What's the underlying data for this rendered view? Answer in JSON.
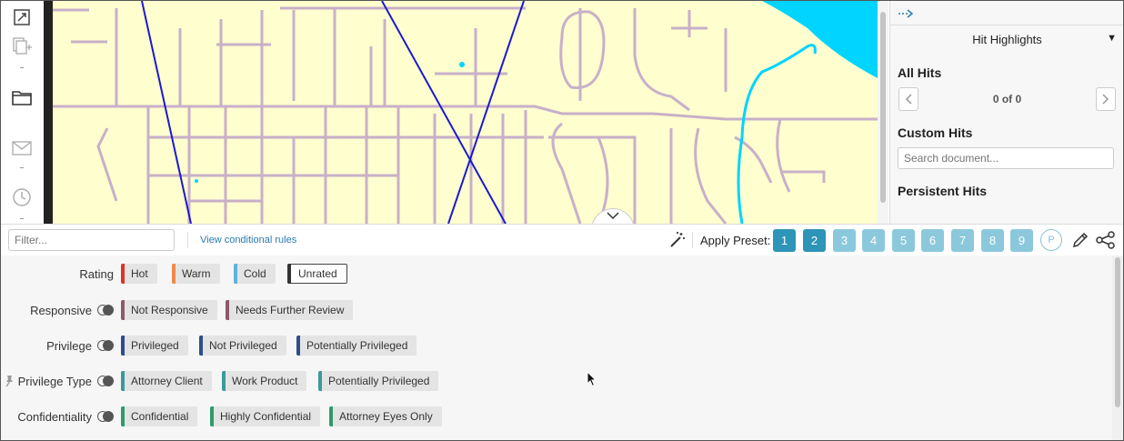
{
  "left_toolbar": {
    "icons": [
      "expand-icon",
      "copy-add-icon",
      "folder-icon",
      "mail-icon",
      "clock-icon"
    ]
  },
  "right_panel": {
    "title": "Hit Highlights",
    "all_hits_label": "All Hits",
    "hits_count": "0 of 0",
    "custom_hits_label": "Custom Hits",
    "search_placeholder": "Search document...",
    "persistent_hits_label": "Persistent Hits"
  },
  "filter_bar": {
    "filter_placeholder": "Filter...",
    "conditional_rules_link": "View conditional rules",
    "apply_preset_label": "Apply Preset:",
    "presets": [
      "1",
      "2",
      "3",
      "4",
      "5",
      "6",
      "7",
      "8",
      "9"
    ],
    "preset_personal": "P",
    "active_presets": [
      "1",
      "2"
    ]
  },
  "coding": {
    "rating": {
      "label": "Rating",
      "choices": [
        {
          "label": "Hot",
          "color": "#d9342b"
        },
        {
          "label": "Warm",
          "color": "#f0894a"
        },
        {
          "label": "Cold",
          "color": "#5ab4dc"
        },
        {
          "label": "Unrated",
          "color": "#333333",
          "selected": true
        }
      ]
    },
    "responsive": {
      "label": "Responsive",
      "choices": [
        {
          "label": "Not Responsive",
          "color": "#8c5a6a"
        },
        {
          "label": "Needs Further Review",
          "color": "#8c5a6a"
        }
      ]
    },
    "privilege": {
      "label": "Privilege",
      "choices": [
        {
          "label": "Privileged",
          "color": "#2d4e8c"
        },
        {
          "label": "Not Privileged",
          "color": "#2d4e8c"
        },
        {
          "label": "Potentially Privileged",
          "color": "#2d4e8c"
        }
      ]
    },
    "privilege_type": {
      "label": "Privilege Type",
      "choices": [
        {
          "label": "Attorney Client",
          "color": "#3a9a9a"
        },
        {
          "label": "Work Product",
          "color": "#3a9a9a"
        },
        {
          "label": "Potentially Privileged",
          "color": "#3a9a9a"
        }
      ]
    },
    "confidentiality": {
      "label": "Confidentiality",
      "choices": [
        {
          "label": "Confidential",
          "color": "#2f9a6a"
        },
        {
          "label": "Highly Confidential",
          "color": "#2f9a6a"
        },
        {
          "label": "Attorney Eyes Only",
          "color": "#2f9a6a"
        }
      ]
    }
  },
  "colors": {
    "map_background": "#fefecf",
    "map_roads": "#c8b0c8",
    "map_water": "#00d4ff",
    "map_lines": "#1a1ad0",
    "preset_active": "#2e94b8",
    "preset_inactive": "#8cc8dc"
  }
}
